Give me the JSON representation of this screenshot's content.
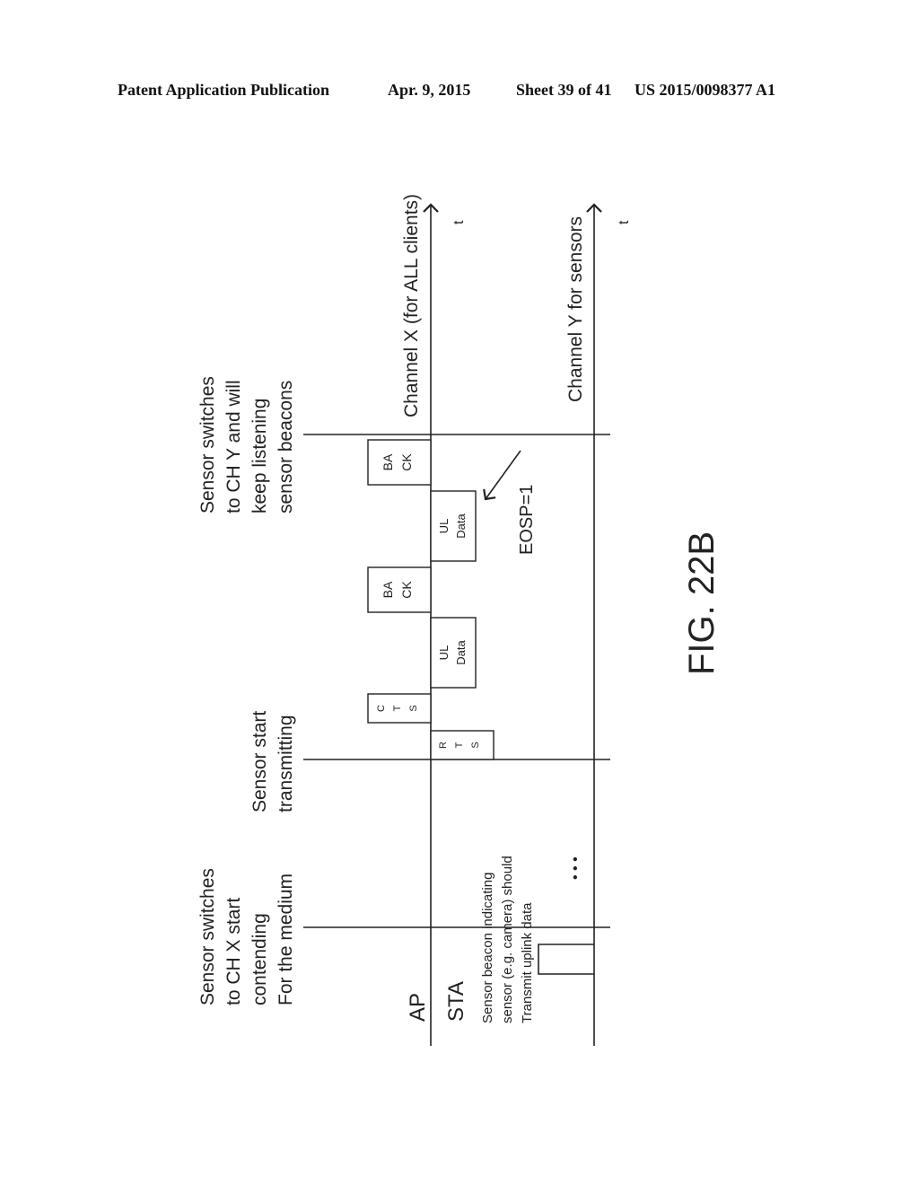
{
  "header": {
    "publication": "Patent Application Publication",
    "date": "Apr. 9, 2015",
    "sheet": "Sheet 39 of 41",
    "number": "US 2015/0098377 A1"
  },
  "figure": {
    "label": "FIG. 22B",
    "channels": {
      "x": "Channel X (for ALL clients)",
      "y": "Channel Y for sensors",
      "time_symbol": "t"
    },
    "rows": {
      "ap": "AP",
      "sta": "STA"
    },
    "events": {
      "switch_x": [
        "Sensor switches",
        "to CH X start",
        "contending",
        "For the medium"
      ],
      "start_tx": [
        "Sensor start",
        "transmitting"
      ],
      "switch_y": [
        "Sensor switches",
        "to CH Y and will",
        "keep listening",
        "sensor beacons"
      ]
    },
    "beacon_note": [
      "Sensor beacon indicating",
      "sensor (e.g. camera) should",
      "Transmit uplink data"
    ],
    "ellipsis": "•  •  •",
    "frames": {
      "rts": [
        "R",
        "T",
        "S"
      ],
      "cts": [
        "C",
        "T",
        "S"
      ],
      "ul_data_1": [
        "UL",
        "Data"
      ],
      "back_1": [
        "BA",
        "CK"
      ],
      "ul_data_2": [
        "UL",
        "Data"
      ],
      "back_2": [
        "BA",
        "CK"
      ]
    },
    "eosp": "EOSP=1"
  }
}
